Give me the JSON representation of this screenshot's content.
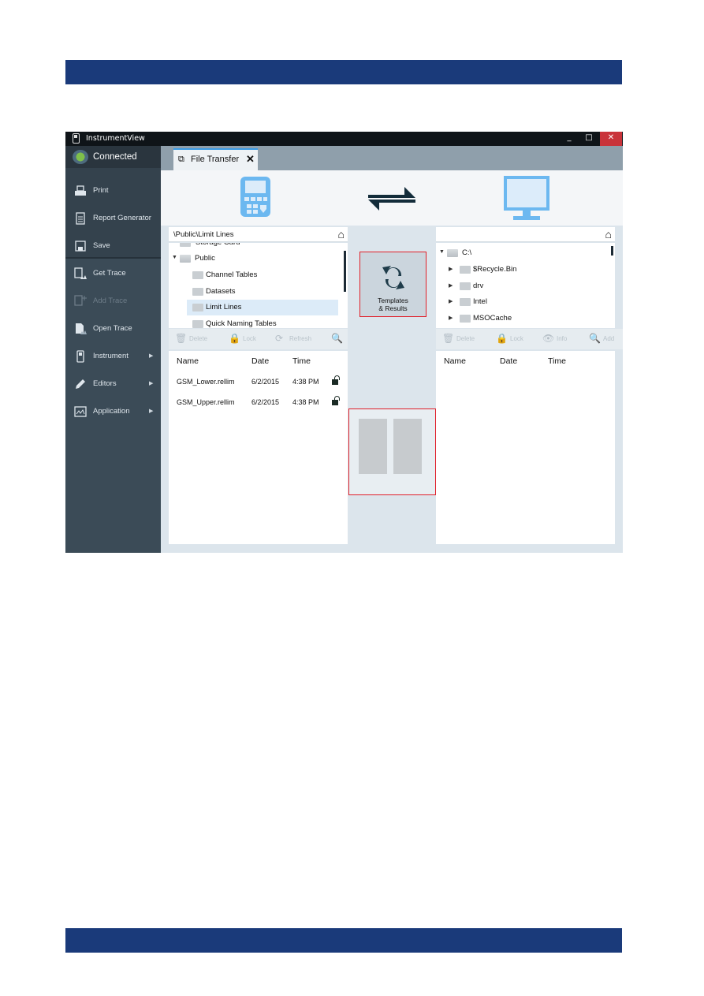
{
  "window": {
    "title": "InstrumentView",
    "controls": {
      "minimize": "_",
      "maximize": "□",
      "close": "✕"
    }
  },
  "sidebar": {
    "connection_status": "Connected",
    "items": [
      {
        "label": "Print",
        "icon": "printer-icon",
        "enabled": true
      },
      {
        "label": "Report Generator",
        "icon": "report-icon",
        "enabled": true
      },
      {
        "label": "Save",
        "icon": "save-icon",
        "enabled": true
      },
      {
        "label": "Get Trace",
        "icon": "get-trace-icon",
        "enabled": true
      },
      {
        "label": "Add Trace",
        "icon": "add-trace-icon",
        "enabled": false
      },
      {
        "label": "Open Trace",
        "icon": "open-trace-icon",
        "enabled": true
      },
      {
        "label": "Instrument",
        "icon": "instrument-icon",
        "enabled": true,
        "submenu": true
      },
      {
        "label": "Editors",
        "icon": "pencil-icon",
        "enabled": true,
        "submenu": true
      },
      {
        "label": "Application",
        "icon": "application-icon",
        "enabled": true,
        "submenu": true
      }
    ],
    "submenu_arrow": "▶"
  },
  "tabs": [
    {
      "label": "File Transfer",
      "icon": "file-transfer-icon",
      "close": "✕"
    }
  ],
  "instrument_panel": {
    "path": "\\Public\\Limit Lines",
    "home_icon": "⌂",
    "tree": [
      {
        "label": "Storage Card",
        "level": 0,
        "partial": true
      },
      {
        "label": "Public",
        "level": 0,
        "expanded": true
      },
      {
        "label": "Channel Tables",
        "level": 1
      },
      {
        "label": "Datasets",
        "level": 1
      },
      {
        "label": "Limit Lines",
        "level": 1,
        "selected": true
      },
      {
        "label": "Quick Naming Tables",
        "level": 1
      }
    ],
    "toolbar": [
      {
        "label": "Delete",
        "icon": "trash-icon"
      },
      {
        "label": "Lock",
        "icon": "lock-icon"
      },
      {
        "label": "Refresh",
        "icon": "refresh-icon"
      },
      {
        "label": "",
        "icon": "search-icon"
      }
    ],
    "columns": [
      "Name",
      "Date",
      "Time"
    ],
    "files": [
      {
        "name": "GSM_Lower.rellim",
        "date": "6/2/2015",
        "time": "4:38 PM",
        "locked": false
      },
      {
        "name": "GSM_Upper.rellim",
        "date": "6/2/2015",
        "time": "4:38 PM",
        "locked": false
      }
    ]
  },
  "center": {
    "swap_icon": "⇄",
    "templates_button": {
      "line1": "Templates",
      "line2": "& Results"
    }
  },
  "pc_panel": {
    "path": "",
    "home_icon": "⌂",
    "tree": [
      {
        "label": "C:\\",
        "level": 0,
        "expanded": true
      },
      {
        "label": "$Recycle.Bin",
        "level": 1
      },
      {
        "label": "drv",
        "level": 1
      },
      {
        "label": "Intel",
        "level": 1
      },
      {
        "label": "MSOCache",
        "level": 1
      }
    ],
    "toolbar": [
      {
        "label": "Delete",
        "icon": "trash-icon"
      },
      {
        "label": "Lock",
        "icon": "lock-icon"
      },
      {
        "label": "Info",
        "icon": "eye-icon"
      },
      {
        "label": "Add",
        "icon": "search-icon"
      }
    ],
    "columns": [
      "Name",
      "Date",
      "Time"
    ],
    "files": []
  },
  "colors": {
    "banner": "#1a3a7a",
    "accent": "#3c9ce6",
    "highlight_box": "#e0202a",
    "sidebar": "#3b4b57"
  }
}
